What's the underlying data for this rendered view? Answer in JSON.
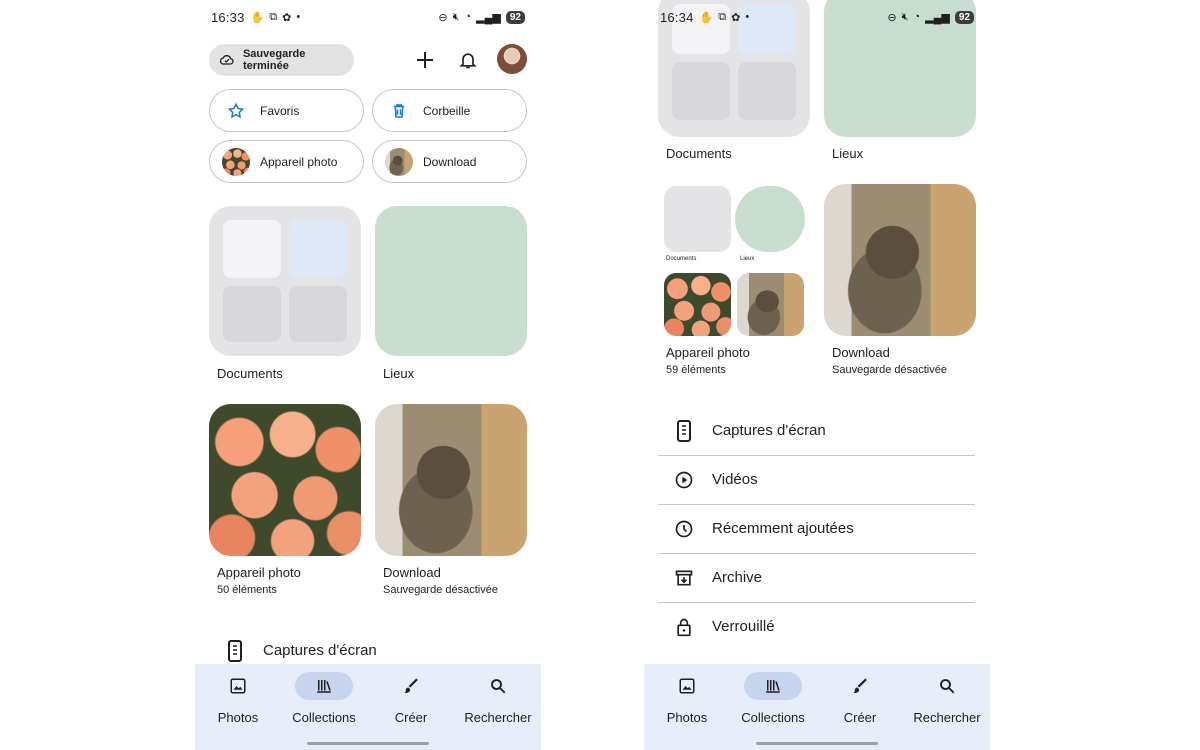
{
  "left": {
    "status": {
      "time": "16:33",
      "battery": "92"
    },
    "backup_label": "Sauvegarde terminée",
    "shortcuts": [
      {
        "label": "Favoris",
        "icon": "star-icon"
      },
      {
        "label": "Corbeille",
        "icon": "trash-icon"
      },
      {
        "label": "Appareil photo",
        "icon": "flower-thumb"
      },
      {
        "label": "Download",
        "icon": "cat-thumb"
      }
    ],
    "albums": [
      {
        "title": "Documents",
        "subtitle": ""
      },
      {
        "title": "Lieux",
        "subtitle": ""
      },
      {
        "title": "Appareil photo",
        "subtitle": "50 éléments"
      },
      {
        "title": "Download",
        "subtitle": "Sauvegarde désactivée"
      }
    ],
    "list": [
      {
        "label": "Captures d'écran",
        "icon": "phone-icon"
      }
    ]
  },
  "right": {
    "status": {
      "time": "16:34",
      "battery": "92"
    },
    "albums": [
      {
        "title": "Documents",
        "subtitle": ""
      },
      {
        "title": "Lieux",
        "subtitle": ""
      },
      {
        "title": "Appareil photo",
        "subtitle": "59 éléments"
      },
      {
        "title": "Download",
        "subtitle": "Sauvegarde désactivée"
      }
    ],
    "mini_labels": {
      "documents": "Documents",
      "lieux": "Lieux"
    },
    "list": [
      {
        "label": "Captures d'écran",
        "icon": "phone-icon"
      },
      {
        "label": "Vidéos",
        "icon": "play-circle-icon"
      },
      {
        "label": "Récemment ajoutées",
        "icon": "clock-icon"
      },
      {
        "label": "Archive",
        "icon": "archive-icon"
      },
      {
        "label": "Verrouillé",
        "icon": "lock-icon"
      }
    ]
  },
  "nav": {
    "items": [
      {
        "label": "Photos",
        "icon": "photo-icon"
      },
      {
        "label": "Collections",
        "icon": "collections-icon",
        "active": true
      },
      {
        "label": "Créer",
        "icon": "brush-icon"
      },
      {
        "label": "Rechercher",
        "icon": "search-icon"
      }
    ]
  },
  "colors": {
    "accent": "#1a73e8",
    "nav_bg": "#e8eef9",
    "nav_active": "#c6d4ee",
    "map": "#c6ddd0"
  }
}
